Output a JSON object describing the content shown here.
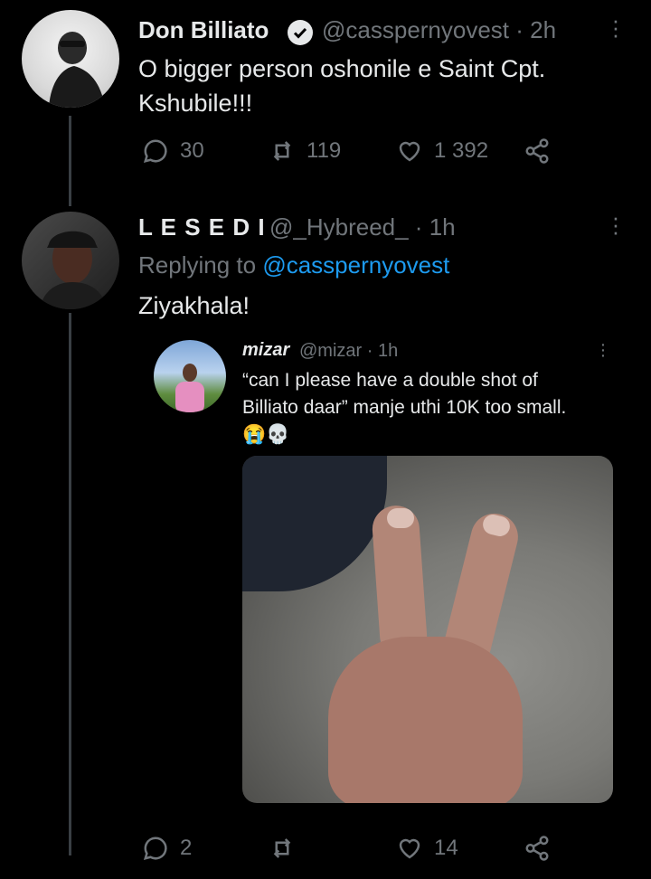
{
  "tweet1": {
    "name": "Don Billiato",
    "handle": "@casspernyovest · 2h",
    "text_line1": "O bigger person oshonile e Saint Cpt.",
    "text_line2": "Kshubile!!!",
    "replies": "30",
    "retweets": "119",
    "likes": "1 392"
  },
  "tweet2": {
    "name": "L E S E D I",
    "handle": "@_Hybreed_ · 1h",
    "replying_prefix": "Replying to",
    "replying_to": "@casspernyovest",
    "text": "Ziyakhala!",
    "replies": "2",
    "likes": "14"
  },
  "quote": {
    "name": "mizar",
    "handle": "@mizar · 1h",
    "text_line1": "“can I please have a double shot of",
    "text_line2": "Billiato daar” manje uthi 10K too small.",
    "emoji": "😭💀"
  },
  "icons": {
    "reply": "reply-icon",
    "retweet": "retweet-icon",
    "like": "heart-icon",
    "share": "share-icon",
    "verified": "verified-badge-icon",
    "more": "more-icon"
  },
  "colors": {
    "background": "#000000",
    "text": "#e7e9ea",
    "muted": "#71767b",
    "link": "#1d9bf0",
    "thread_line": "#3a3f44"
  }
}
